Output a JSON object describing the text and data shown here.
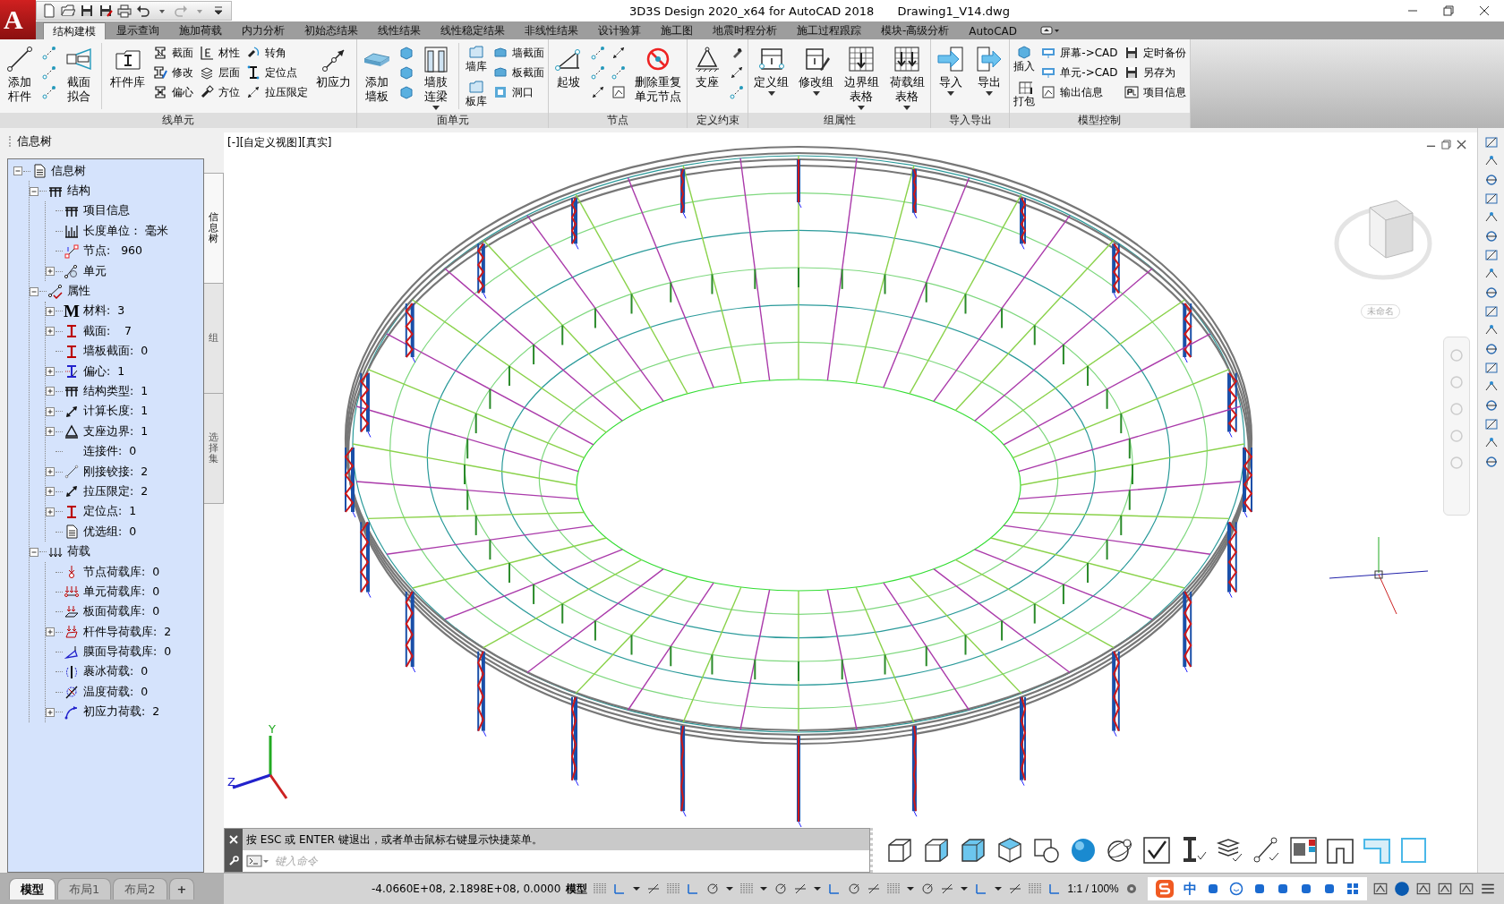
{
  "app_button": {
    "label": "A"
  },
  "title_bar": {
    "title": "3D3S Design 2020_x64 for AutoCAD 2018",
    "document": "Drawing1_V14.dwg"
  },
  "ribbon_tabs": [
    {
      "label": "结构建模",
      "selected": true
    },
    {
      "label": "显示查询",
      "selected": false
    },
    {
      "label": "施加荷载",
      "selected": false
    },
    {
      "label": "内力分析",
      "selected": false
    },
    {
      "label": "初始态结果",
      "selected": false
    },
    {
      "label": "线性结果",
      "selected": false
    },
    {
      "label": "线性稳定结果",
      "selected": false
    },
    {
      "label": "非线性结果",
      "selected": false
    },
    {
      "label": "设计验算",
      "selected": false
    },
    {
      "label": "施工图",
      "selected": false
    },
    {
      "label": "地震时程分析",
      "selected": false
    },
    {
      "label": "施工过程跟踪",
      "selected": false
    },
    {
      "label": "模块-高级分析",
      "selected": false
    },
    {
      "label": "AutoCAD",
      "selected": false
    }
  ],
  "ribbon_panels": [
    {
      "title": "线单元",
      "groups": [
        {
          "kind": "large",
          "label": "添加杆件"
        },
        {
          "kind": "icons"
        },
        {
          "kind": "large",
          "label": "截面拟合"
        },
        {
          "kind": "separator"
        },
        {
          "kind": "large",
          "label": "杆件库"
        },
        {
          "kind": "stack",
          "items": [
            "截面",
            "修改",
            "偏心"
          ]
        },
        {
          "kind": "stack",
          "items": [
            "材性",
            "层面",
            "方位"
          ]
        },
        {
          "kind": "stack",
          "items": [
            "转角",
            "定位点",
            "拉压限定"
          ]
        },
        {
          "kind": "large",
          "label": "初应力"
        }
      ]
    },
    {
      "title": "面单元",
      "groups": [
        {
          "kind": "large",
          "label": "添加墙板"
        },
        {
          "kind": "icons"
        },
        {
          "kind": "large",
          "label": "墙肢连梁",
          "dropdown": true
        },
        {
          "kind": "separator"
        },
        {
          "kind": "mini",
          "items": [
            "墙库",
            "板库"
          ]
        },
        {
          "kind": "stack",
          "items": [
            "墙截面",
            "板截面",
            "洞口"
          ]
        }
      ]
    },
    {
      "title": "节点",
      "groups": [
        {
          "kind": "large",
          "label": "起坡"
        },
        {
          "kind": "icons"
        },
        {
          "kind": "icons"
        },
        {
          "kind": "large",
          "label": "删除重复单元节点"
        }
      ]
    },
    {
      "title": "定义约束",
      "groups": [
        {
          "kind": "large",
          "label": "支座"
        },
        {
          "kind": "icons"
        }
      ]
    },
    {
      "title": "组属性",
      "groups": [
        {
          "kind": "large",
          "label": "定义组",
          "dropdown": true
        },
        {
          "kind": "large",
          "label": "修改组",
          "dropdown": true
        },
        {
          "kind": "large",
          "label": "边界组表格",
          "dropdown": true
        },
        {
          "kind": "large",
          "label": "荷载组表格",
          "dropdown": true
        }
      ]
    },
    {
      "title": "导入导出",
      "groups": [
        {
          "kind": "large",
          "label": "导入",
          "dropdown": true
        },
        {
          "kind": "large",
          "label": "导出",
          "dropdown": true
        }
      ]
    },
    {
      "title": "模型控制",
      "groups": [
        {
          "kind": "mini",
          "items": [
            "插入",
            "打包"
          ]
        },
        {
          "kind": "stack",
          "items": [
            "屏幕->CAD",
            "单元->CAD",
            "输出信息"
          ]
        },
        {
          "kind": "stack",
          "items": [
            "定时备份",
            "另存为",
            "项目信息"
          ]
        }
      ]
    }
  ],
  "info_panel": {
    "title": "信息树",
    "tree": [
      {
        "label": "信息树",
        "expanded": true,
        "children": [
          {
            "label": "结构",
            "expanded": true,
            "children": [
              {
                "label": "项目信息"
              },
              {
                "label": "长度单位： 毫米"
              },
              {
                "label": "节点:   960"
              },
              {
                "label": "单元",
                "expanded": false
              }
            ]
          },
          {
            "label": "属性",
            "expanded": true,
            "children": [
              {
                "label": "材料:  3",
                "glyph": "M",
                "expanded": false
              },
              {
                "label": "截面:    7",
                "expanded": false
              },
              {
                "label": "墙板截面:  0"
              },
              {
                "label": "偏心:  1",
                "expanded": false
              },
              {
                "label": "结构类型:  1",
                "expanded": false
              },
              {
                "label": "计算长度:  1",
                "expanded": false
              },
              {
                "label": "支座边界:  1",
                "expanded": false
              },
              {
                "label": "连接件:  0"
              },
              {
                "label": "刚接铰接:  2",
                "expanded": false
              },
              {
                "label": "拉压限定:  2",
                "expanded": false
              },
              {
                "label": "定位点:  1",
                "expanded": false
              },
              {
                "label": "优选组:  0"
              }
            ]
          },
          {
            "label": "荷载",
            "expanded": true,
            "children": [
              {
                "label": "节点荷载库:  0"
              },
              {
                "label": "单元荷载库:  0"
              },
              {
                "label": "板面荷载库:  0"
              },
              {
                "label": "杆件导荷载库:  2",
                "expanded": false
              },
              {
                "label": "膜面导荷载库:  0"
              },
              {
                "label": "裹冰荷载:  0"
              },
              {
                "label": "温度荷载:  0"
              },
              {
                "label": "初应力荷载:  2",
                "expanded": false
              }
            ]
          }
        ]
      }
    ],
    "side_tabs": [
      {
        "label": "信息树",
        "selected": true
      },
      {
        "label": "组",
        "selected": false
      },
      {
        "label": "选择集",
        "selected": false
      }
    ]
  },
  "viewport": {
    "label": "[-][自定义视图][真实]",
    "viewcube_label": "未命名",
    "axis_labels": [
      "Y",
      "Z"
    ]
  },
  "command_line": {
    "history": "按 ESC 或 ENTER 键退出，或者单击鼠标右键显示快捷菜单。",
    "placeholder": "键入命令"
  },
  "layout_tabs": [
    {
      "label": "模型",
      "selected": true
    },
    {
      "label": "布局1",
      "selected": false
    },
    {
      "label": "布局2",
      "selected": false
    }
  ],
  "new_layout": "+",
  "status_bar": {
    "coordinates": "-4.0660E+08, 2.1898E+08, 0.0000",
    "space": "模型",
    "scale": "1:1 / 100%",
    "ime": "中"
  }
}
